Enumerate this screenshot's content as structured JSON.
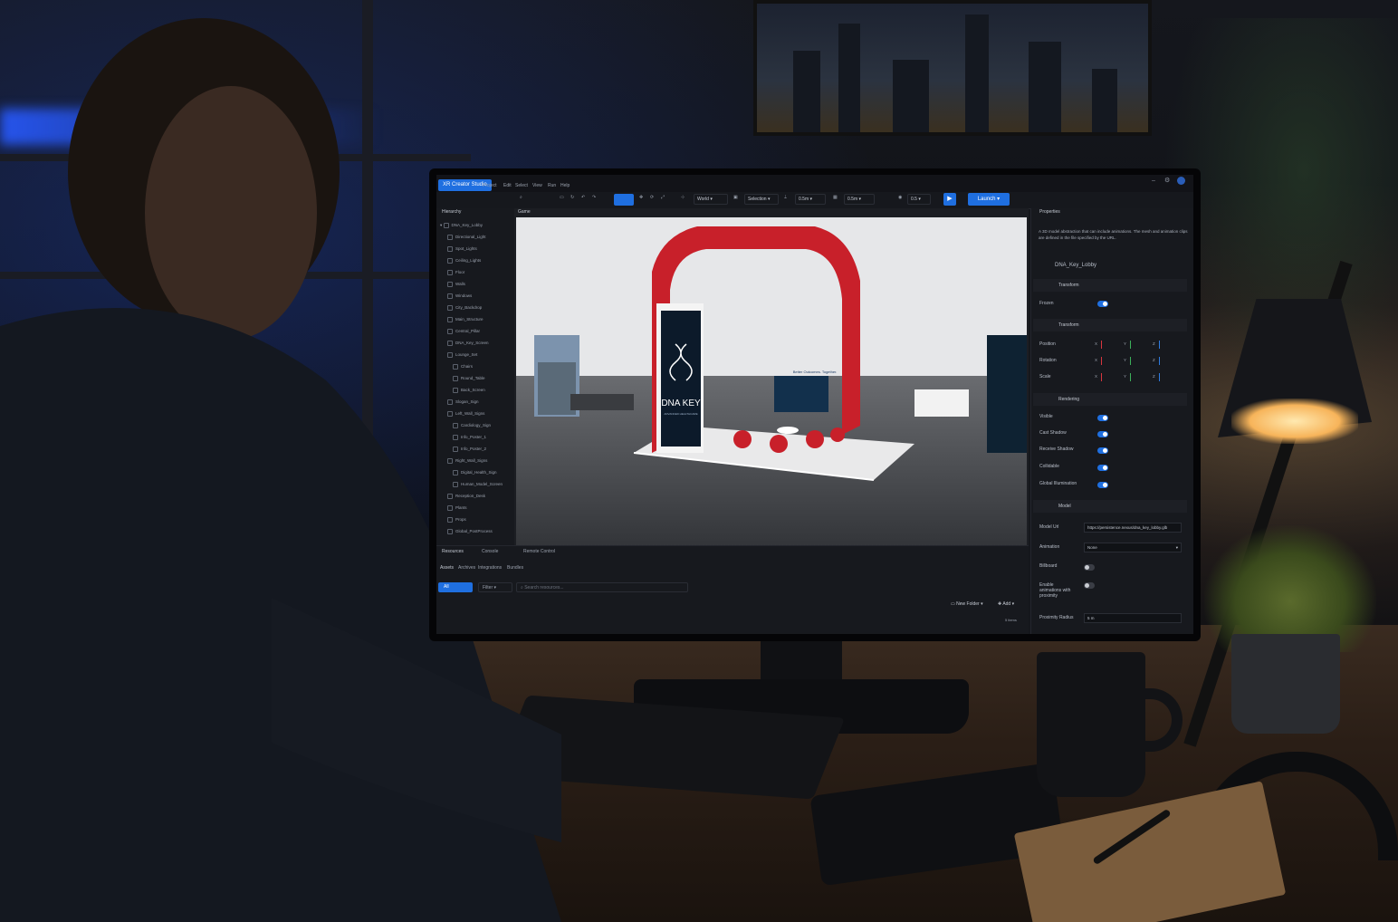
{
  "app": {
    "brand": "XR Creator Studio",
    "menu": [
      "Project",
      "Edit",
      "Select",
      "View",
      "Run",
      "Help"
    ]
  },
  "toolbar": {
    "space": "World",
    "mode": "Selection",
    "snap": "0.5m",
    "grid": "0.5m",
    "extra": "0.5",
    "launch": "Launch"
  },
  "hierarchy": {
    "tab": "Hierarchy",
    "root": "DNA_Key_Lobby",
    "items": [
      {
        "label": "Directional_Light",
        "depth": 1
      },
      {
        "label": "Spot_Lights",
        "depth": 1
      },
      {
        "label": "Ceiling_Lights",
        "depth": 1
      },
      {
        "label": "Floor",
        "depth": 1
      },
      {
        "label": "Walls",
        "depth": 1
      },
      {
        "label": "Windows",
        "depth": 1
      },
      {
        "label": "City_Backdrop",
        "depth": 1
      },
      {
        "label": "Main_Structure",
        "depth": 1
      },
      {
        "label": "Central_Pillar",
        "depth": 1
      },
      {
        "label": "DNA_Key_Screen",
        "depth": 1
      },
      {
        "label": "Lounge_Set",
        "depth": 1
      },
      {
        "label": "Chairs",
        "depth": 2
      },
      {
        "label": "Round_Table",
        "depth": 2
      },
      {
        "label": "Back_Screen",
        "depth": 2
      },
      {
        "label": "Slogan_Sign",
        "depth": 1
      },
      {
        "label": "Left_Wall_Signs",
        "depth": 1
      },
      {
        "label": "Cardiology_Sign",
        "depth": 2
      },
      {
        "label": "Info_Poster_1",
        "depth": 2
      },
      {
        "label": "Info_Poster_2",
        "depth": 2
      },
      {
        "label": "Right_Wall_Signs",
        "depth": 1
      },
      {
        "label": "Digital_Health_Sign",
        "depth": 2
      },
      {
        "label": "Human_Model_Screen",
        "depth": 2
      },
      {
        "label": "Reception_Desk",
        "depth": 1
      },
      {
        "label": "Plants",
        "depth": 1
      },
      {
        "label": "Props",
        "depth": 1
      },
      {
        "label": "Global_PostProcess",
        "depth": 1
      }
    ]
  },
  "viewport": {
    "tab": "Game",
    "kiosk_title": "DNA KEY",
    "kiosk_sub": "ADVANCED HEALTHCARE",
    "slogan": "Better Outcomes. Together."
  },
  "bottom": {
    "tabs": [
      "Resources",
      "Console",
      "Remote Control"
    ],
    "subtabs": [
      "Assets",
      "Archives",
      "Integrations",
      "Bundles"
    ],
    "all": "All",
    "filter": "Filter",
    "search_placeholder": "Search resources...",
    "new_folder": "New Folder",
    "add": "Add",
    "items_count": "5 items"
  },
  "properties": {
    "tab": "Properties",
    "description": "A 3D model abstraction that can include animations. The mesh and animation clips are defined in the file specified by the URL.",
    "entity_name": "DNA_Key_Lobby",
    "transform_section": "Transform",
    "frozen_label": "Frozen",
    "transform2_section": "Transform",
    "position_label": "Position",
    "rotation_label": "Rotation",
    "scale_label": "Scale",
    "rendering_section": "Rendering",
    "visible_label": "Visible",
    "cast_shadow_label": "Cast Shadow",
    "receive_shadow_label": "Receive Shadow",
    "collidable_label": "Collidable",
    "gi_label": "Global Illumination",
    "model_section": "Model",
    "model_url_label": "Model Url",
    "model_url": "https://persistence.nexus/dna_key_lobby.glb",
    "animation_label": "Animation",
    "animation_value": "None",
    "billboard_label": "Billboard",
    "enable_anim_label": "Enable animations with proximity",
    "proximity_label": "Proximity Radius",
    "proximity_value": "5 m",
    "toggles": {
      "frozen": true,
      "visible": true,
      "cast_shadow": true,
      "receive_shadow": true,
      "collidable": true,
      "gi": true,
      "billboard": false,
      "enable_anim": false
    }
  },
  "colors": {
    "accent": "#1f6fe0",
    "panel": "#17191e",
    "kiosk_red": "#c8202a"
  }
}
